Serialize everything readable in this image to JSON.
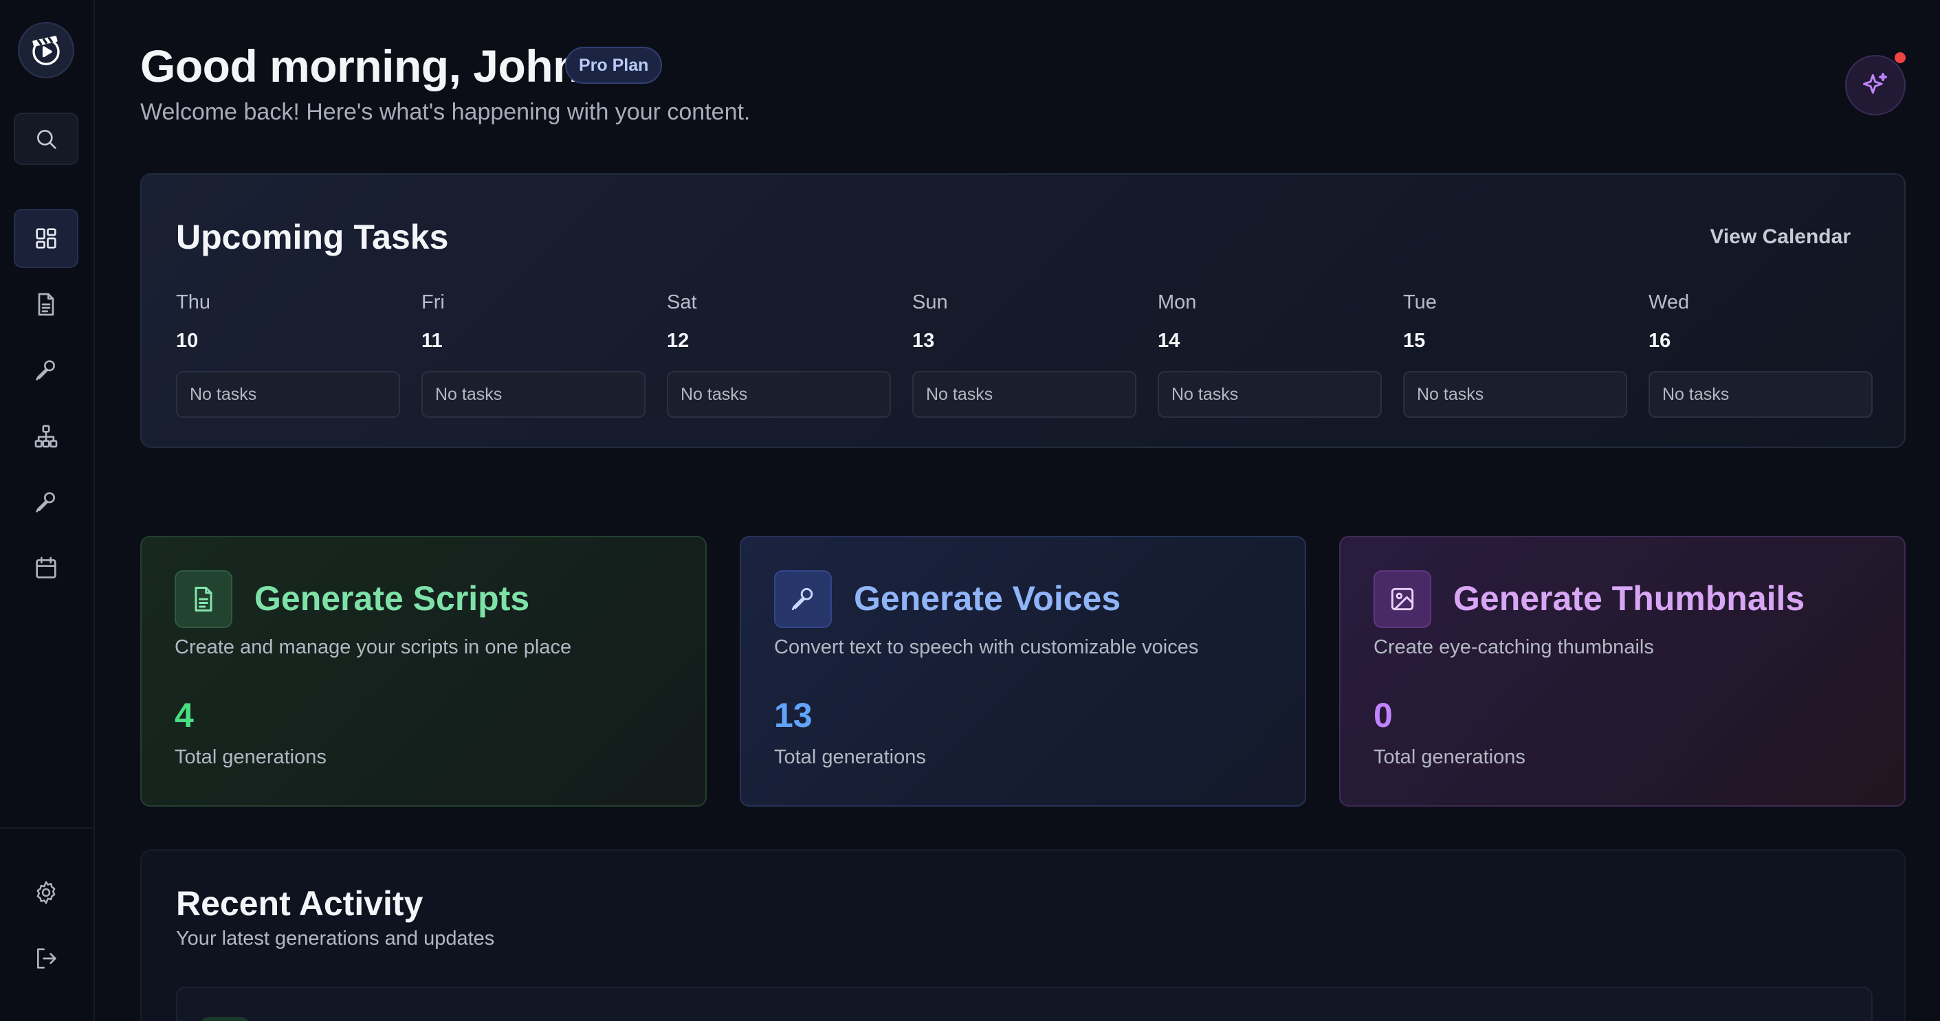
{
  "header": {
    "greeting": "Good morning, John",
    "plan_badge": "Pro Plan",
    "welcome": "Welcome back! Here's what's happening with your content."
  },
  "sidebar": {
    "items": [
      {
        "icon": "dashboard-icon",
        "active": true
      },
      {
        "icon": "document-icon",
        "active": false
      },
      {
        "icon": "microphone-icon",
        "active": false
      },
      {
        "icon": "hierarchy-icon",
        "active": false
      },
      {
        "icon": "microphone-icon",
        "active": false
      },
      {
        "icon": "calendar-icon",
        "active": false
      }
    ],
    "bottom": [
      {
        "icon": "gear-icon"
      },
      {
        "icon": "logout-icon"
      }
    ]
  },
  "tasks": {
    "title": "Upcoming Tasks",
    "view_calendar": "View Calendar",
    "days": [
      {
        "name": "Thu",
        "num": "10",
        "status": "No tasks"
      },
      {
        "name": "Fri",
        "num": "11",
        "status": "No tasks"
      },
      {
        "name": "Sat",
        "num": "12",
        "status": "No tasks"
      },
      {
        "name": "Sun",
        "num": "13",
        "status": "No tasks"
      },
      {
        "name": "Mon",
        "num": "14",
        "status": "No tasks"
      },
      {
        "name": "Tue",
        "num": "15",
        "status": "No tasks"
      },
      {
        "name": "Wed",
        "num": "16",
        "status": "No tasks"
      }
    ]
  },
  "features": [
    {
      "title": "Generate Scripts",
      "description": "Create and manage your scripts in one place",
      "count": "4",
      "count_label": "Total generations",
      "icon": "document-icon",
      "accent": "#4ade80"
    },
    {
      "title": "Generate Voices",
      "description": "Convert text to speech with customizable voices",
      "count": "13",
      "count_label": "Total generations",
      "icon": "microphone-icon",
      "accent": "#60a5fa"
    },
    {
      "title": "Generate Thumbnails",
      "description": "Create eye-catching thumbnails",
      "count": "0",
      "count_label": "Total generations",
      "icon": "image-icon",
      "accent": "#c084fc"
    }
  ],
  "activity": {
    "title": "Recent Activity",
    "subtitle": "Your latest generations and updates"
  },
  "colors": {
    "background": "#0b0e17",
    "sidebar": "#0a0d15",
    "notification": "#ef4444"
  }
}
